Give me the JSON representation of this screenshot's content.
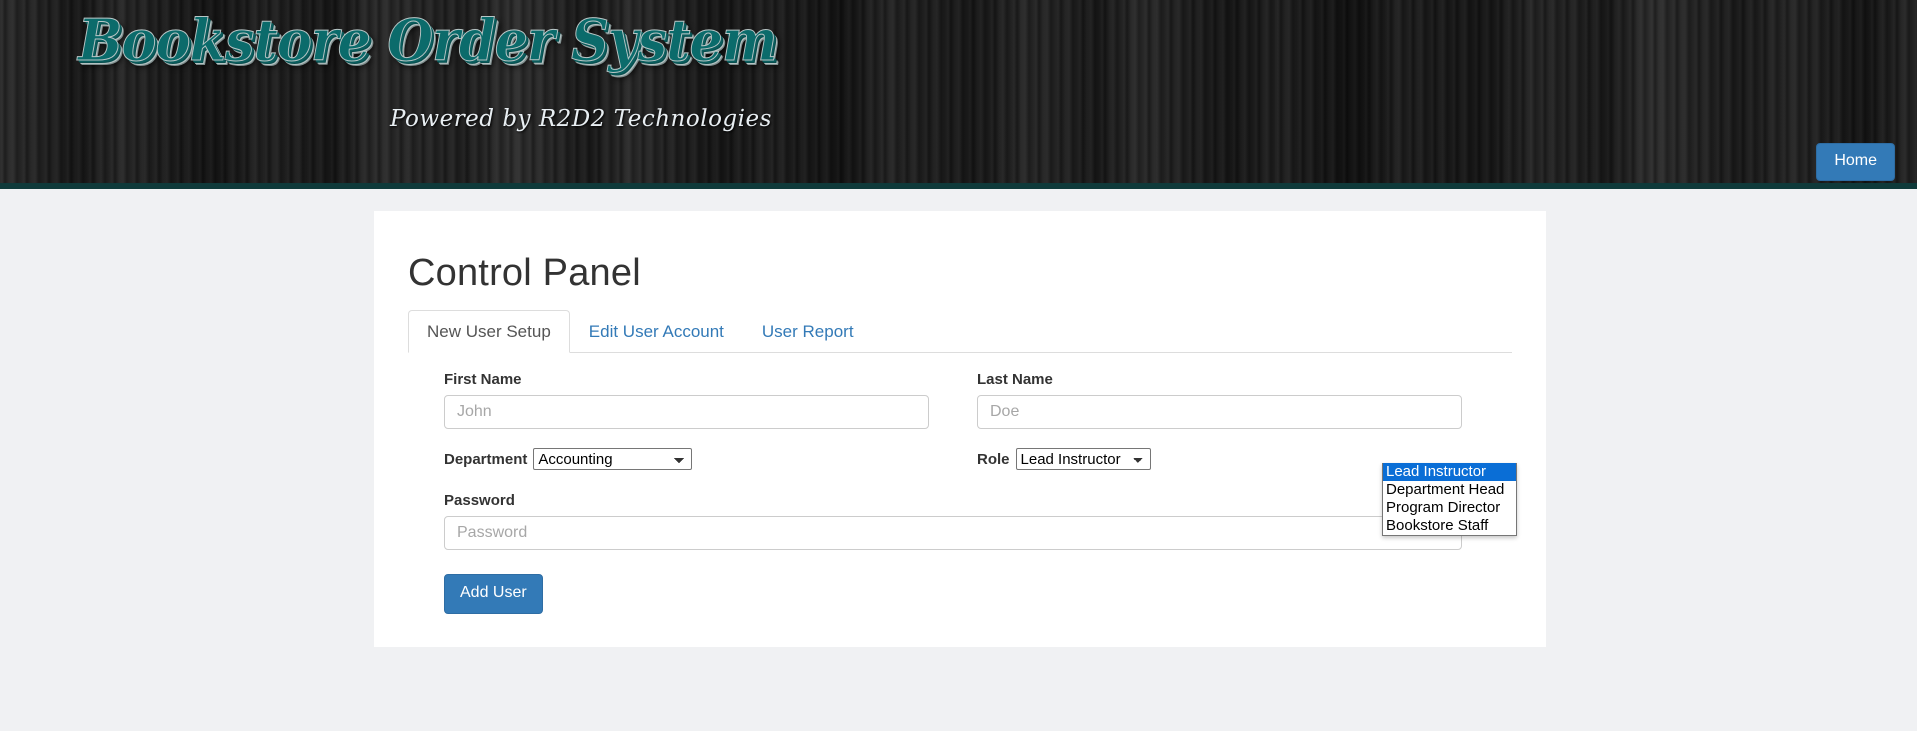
{
  "header": {
    "logo_text": "Bookstore Order System",
    "tagline": "Powered by R2D2 Technologies",
    "home_label": "Home",
    "accent_color": "#0b6b6b",
    "button_color": "#337ab7",
    "border_color": "#0f3a3a"
  },
  "main": {
    "page_title": "Control Panel",
    "tabs": [
      {
        "label": "New User Setup",
        "active": true
      },
      {
        "label": "Edit User Account",
        "active": false
      },
      {
        "label": "User Report",
        "active": false
      }
    ]
  },
  "form": {
    "first_name": {
      "label": "First Name",
      "placeholder": "John",
      "value": ""
    },
    "last_name": {
      "label": "Last Name",
      "placeholder": "Doe",
      "value": ""
    },
    "department": {
      "label": "Department",
      "selected": "Accounting"
    },
    "role": {
      "label": "Role",
      "selected": "Lead Instructor",
      "open": true,
      "options": [
        "Lead Instructor",
        "Department Head",
        "Program Director",
        "Bookstore Staff"
      ],
      "highlight_color": "#0a6ed6"
    },
    "password": {
      "label": "Password",
      "placeholder": "Password",
      "value": ""
    },
    "submit_label": "Add User"
  }
}
